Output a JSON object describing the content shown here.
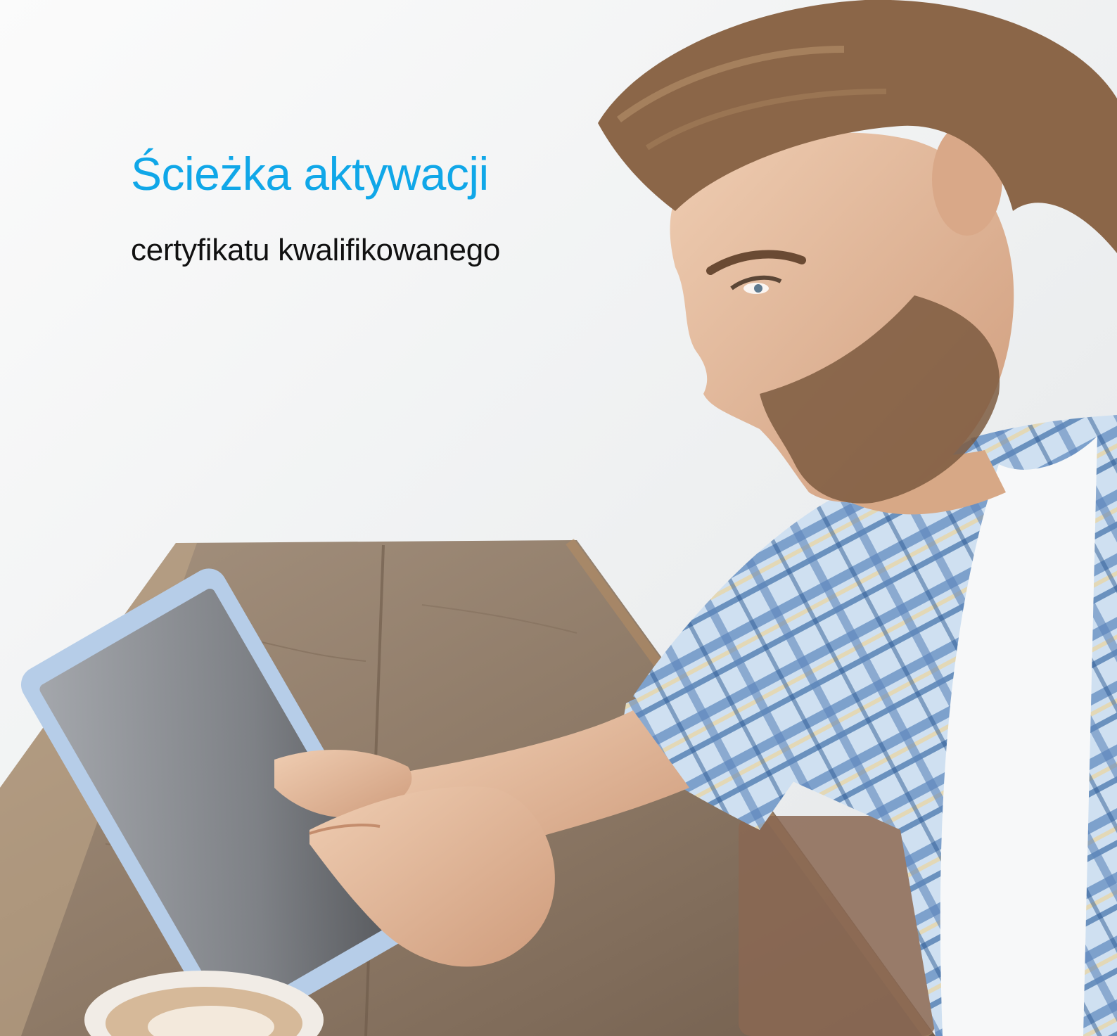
{
  "cover": {
    "title": "Ścieżka aktywacji",
    "subtitle": "certyfikatu kwalifikowanego"
  },
  "colors": {
    "title": "#10a7e8",
    "subtitle": "#111111",
    "background": "#f3f4f5",
    "table_wood": "#8f7a66",
    "shirt_blue": "#6f96c6",
    "shirt_light": "#c6dcef",
    "tablet_frame": "#a9c5e6",
    "tablet_screen": "#8d9096",
    "skin": "#e4b899",
    "hair": "#8b6648"
  },
  "photo": {
    "subject": "man-with-tablet-photo"
  }
}
